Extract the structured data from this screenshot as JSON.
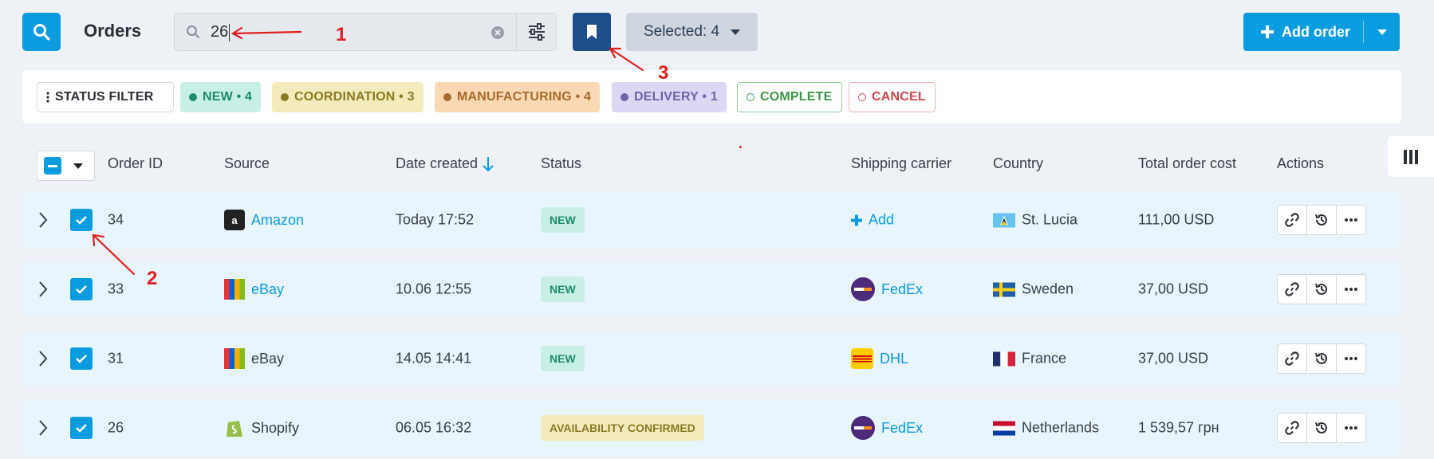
{
  "header": {
    "title": "Orders",
    "search_value": "26",
    "selected_label": "Selected: 4",
    "add_order_label": "Add order"
  },
  "status_filter": {
    "label": "STATUS FILTER",
    "chips": [
      {
        "label": "NEW • 4",
        "color": "#1f8b6b"
      },
      {
        "label": "COORDINATION • 3",
        "color": "#8a7a23"
      },
      {
        "label": "MANUFACTURING • 4",
        "color": "#a86a2d"
      },
      {
        "label": "DELIVERY • 1",
        "color": "#6e62a8"
      },
      {
        "label": "COMPLETE",
        "color": "#3c9844"
      },
      {
        "label": "CANCEL",
        "color": "#d0464a"
      }
    ]
  },
  "table": {
    "columns": {
      "order_id": "Order ID",
      "source": "Source",
      "date_created": "Date created",
      "status": "Status",
      "shipping_carrier": "Shipping carrier",
      "country": "Country",
      "total": "Total order cost",
      "actions": "Actions"
    },
    "rows": [
      {
        "id": "34",
        "source": "Amazon",
        "date": "Today 17:52",
        "status": "NEW",
        "carrier": "Add",
        "country": "St. Lucia",
        "total": "111,00 USD"
      },
      {
        "id": "33",
        "source": "eBay",
        "date": "10.06 12:55",
        "status": "NEW",
        "carrier": "FedEx",
        "country": "Sweden",
        "total": "37,00 USD"
      },
      {
        "id": "31",
        "source": "eBay",
        "date": "14.05 14:41",
        "status": "NEW",
        "carrier": "DHL",
        "country": "France",
        "total": "37,00 USD"
      },
      {
        "id": "26",
        "source": "Shopify",
        "date": "06.05 16:32",
        "status": "AVAILABILITY CONFIRMED",
        "carrier": "FedEx",
        "country": "Netherlands",
        "total": "1 539,57 грн"
      }
    ]
  },
  "annotations": [
    "1",
    "2",
    "3"
  ],
  "colors": {
    "accent": "#0b9ce0",
    "bookmark": "#1d4d8a",
    "annotation": "#e02020"
  }
}
